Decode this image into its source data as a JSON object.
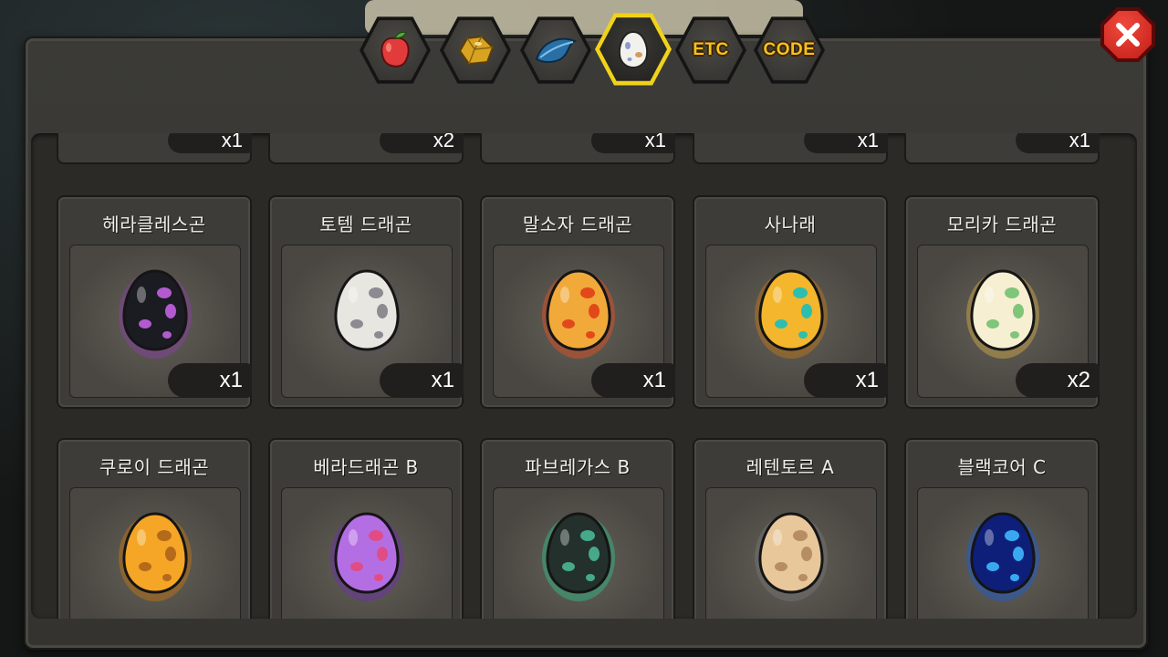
{
  "tabs": [
    {
      "id": "fruit",
      "icon": "red-fruit-icon",
      "label": ""
    },
    {
      "id": "gold",
      "icon": "gold-nugget-icon",
      "label": ""
    },
    {
      "id": "feather",
      "icon": "blue-feather-icon",
      "label": ""
    },
    {
      "id": "egg",
      "icon": "egg-icon",
      "label": "",
      "active": true
    },
    {
      "id": "etc",
      "icon": "",
      "label": "ETC"
    },
    {
      "id": "code",
      "icon": "",
      "label": "CODE"
    }
  ],
  "top_row_qty": [
    "x1",
    "x2",
    "x1",
    "x1",
    "x1"
  ],
  "cards": [
    {
      "name": "헤라클레스곤",
      "qty": "x1",
      "egg": {
        "base": "#1b1b22",
        "spot": "#b25bcf",
        "glow": "#8b3fa8"
      }
    },
    {
      "name": "토템 드래곤",
      "qty": "x1",
      "egg": {
        "base": "#e8e6e0",
        "spot": "#8d8a92",
        "glow": "#555"
      }
    },
    {
      "name": "말소자 드래곤",
      "qty": "x1",
      "egg": {
        "base": "#f1a93a",
        "spot": "#e2491a",
        "glow": "#e8521e"
      }
    },
    {
      "name": "사나래",
      "qty": "x1",
      "egg": {
        "base": "#f3b62c",
        "spot": "#2cbfb0",
        "glow": "#c77b14"
      }
    },
    {
      "name": "모리카 드래곤",
      "qty": "x2",
      "egg": {
        "base": "#f6efd2",
        "spot": "#7fc57a",
        "glow": "#d8b04a"
      }
    },
    {
      "name": "쿠로이 드래곤",
      "qty": "",
      "egg": {
        "base": "#f5a626",
        "spot": "#b56a1b",
        "glow": "#c7780d"
      }
    },
    {
      "name": "베라드래곤 B",
      "qty": "",
      "egg": {
        "base": "#b46ee4",
        "spot": "#e04d86",
        "glow": "#6e2fb0"
      }
    },
    {
      "name": "파브레가스 B",
      "qty": "",
      "egg": {
        "base": "#24302c",
        "spot": "#46a989",
        "glow": "#2ec08a"
      }
    },
    {
      "name": "레텐토르 A",
      "qty": "",
      "egg": {
        "base": "#e8c79a",
        "spot": "#b78d63",
        "glow": "#777"
      }
    },
    {
      "name": "블랙코어 C",
      "qty": "",
      "egg": {
        "base": "#0e1f7a",
        "spot": "#39a8f0",
        "glow": "#1a5ed4"
      }
    }
  ],
  "colors": {
    "accent": "#f1d21a",
    "close": "#e03a2f",
    "panel": "#3b3a36"
  }
}
